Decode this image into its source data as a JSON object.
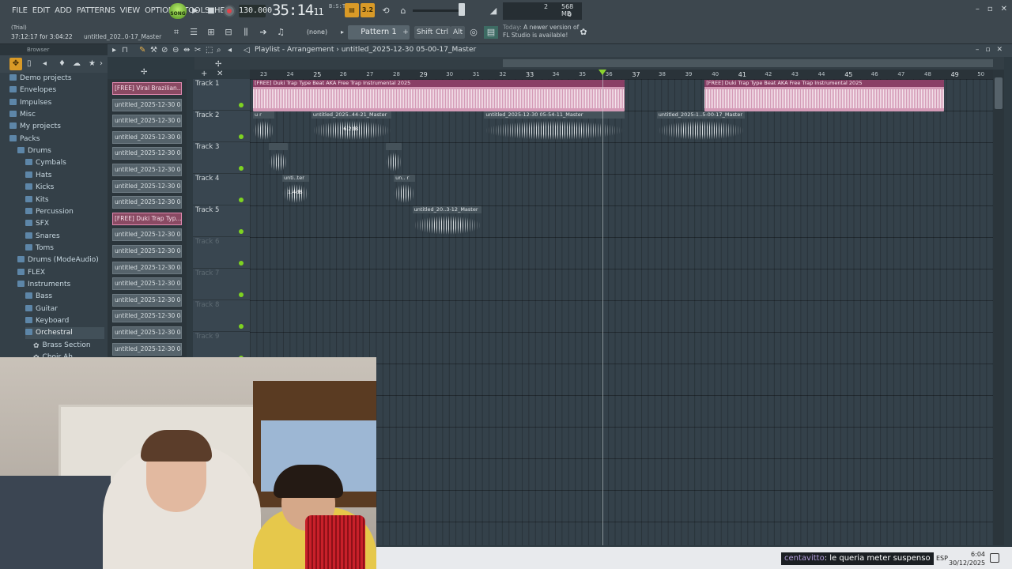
{
  "menu": [
    "FILE",
    "EDIT",
    "ADD",
    "PATTERNS",
    "VIEW",
    "OPTIONS",
    "TOOLS",
    "HELP"
  ],
  "transport": {
    "song_label": "SONG",
    "tempo": "130.000",
    "time": "35:14",
    "time_frac": "11",
    "time_unit": "B:S:T"
  },
  "toggles": {
    "metro": "3.2"
  },
  "cpu": {
    "voices": "2",
    "mem": "568 MB",
    "poly": "0"
  },
  "status": {
    "trial": "(Trial)",
    "hint_time": "37:12:17 for 3:04:22",
    "hint_file": "untitled_202..0-17_Master"
  },
  "pattern": {
    "none_label": "(none)",
    "name": "Pattern 1"
  },
  "modifiers": [
    "Shift",
    "Ctrl",
    "Alt"
  ],
  "news": {
    "line1_a": "Today:",
    "line1_b": "A newer version of",
    "line2": "FL Studio is available!"
  },
  "browser": {
    "title": "Browser",
    "items": [
      {
        "label": "Demo projects",
        "indent": 0
      },
      {
        "label": "Envelopes",
        "indent": 0
      },
      {
        "label": "Impulses",
        "indent": 0
      },
      {
        "label": "Misc",
        "indent": 0
      },
      {
        "label": "My projects",
        "indent": 0
      },
      {
        "label": "Packs",
        "indent": 0
      },
      {
        "label": "Drums",
        "indent": 1
      },
      {
        "label": "Cymbals",
        "indent": 2
      },
      {
        "label": "Hats",
        "indent": 2
      },
      {
        "label": "Kicks",
        "indent": 2
      },
      {
        "label": "Kits",
        "indent": 2
      },
      {
        "label": "Percussion",
        "indent": 2
      },
      {
        "label": "SFX",
        "indent": 2
      },
      {
        "label": "Snares",
        "indent": 2
      },
      {
        "label": "Toms",
        "indent": 2
      },
      {
        "label": "Drums (ModeAudio)",
        "indent": 1
      },
      {
        "label": "FLEX",
        "indent": 1
      },
      {
        "label": "Instruments",
        "indent": 1
      },
      {
        "label": "Bass",
        "indent": 2
      },
      {
        "label": "Guitar",
        "indent": 2
      },
      {
        "label": "Keyboard",
        "indent": 2
      },
      {
        "label": "Orchestral",
        "indent": 2
      },
      {
        "label": "Brass Section",
        "indent": 3
      },
      {
        "label": "Choir Ah",
        "indent": 3
      }
    ]
  },
  "clip_list": [
    {
      "label": "[FREE] Viral Brazilian...",
      "hl": true
    },
    {
      "label": "untitled_2025-12-30 04-",
      "hl": false
    },
    {
      "label": "untitled_2025-12-30 04-",
      "hl": false
    },
    {
      "label": "untitled_2025-12-30 04-",
      "hl": false
    },
    {
      "label": "untitled_2025-12-30 04-",
      "hl": false
    },
    {
      "label": "untitled_2025-12-30 04-",
      "hl": false
    },
    {
      "label": "untitled_2025-12-30 04-",
      "hl": false
    },
    {
      "label": "untitled_2025-12-30 04-",
      "hl": false
    },
    {
      "label": "[FREE] Duki Trap Typ...",
      "hl": true
    },
    {
      "label": "untitled_2025-12-30 04-",
      "hl": false
    },
    {
      "label": "untitled_2025-12-30 04-",
      "hl": false
    },
    {
      "label": "untitled_2025-12-30 04-",
      "hl": false
    },
    {
      "label": "untitled_2025-12-30 04-",
      "hl": false
    },
    {
      "label": "untitled_2025-12-30 04-",
      "hl": false
    },
    {
      "label": "untitled_2025-12-30 04-",
      "hl": false
    },
    {
      "label": "untitled_2025-12-30 04-",
      "hl": false
    },
    {
      "label": "untitled_2025-12-30 04-",
      "hl": false
    }
  ],
  "playlist": {
    "title": "Playlist - Arrangement",
    "separator": "›",
    "pattern": "untitled_2025-12-30 05-00-17_Master",
    "ruler": [
      "23",
      "24",
      "25",
      "26",
      "27",
      "28",
      "29",
      "30",
      "31",
      "32",
      "33",
      "34",
      "35",
      "36",
      "37",
      "38",
      "39",
      "40",
      "41",
      "42",
      "43",
      "44",
      "45",
      "46",
      "47",
      "48",
      "49",
      "50"
    ],
    "tracks": [
      "Track 1",
      "Track 2",
      "Track 3",
      "Track 4",
      "Track 5",
      "Track 6",
      "Track 7",
      "Track 8",
      "Track 9"
    ],
    "clips": [
      {
        "track": 0,
        "start": 23,
        "len": 14,
        "name": "[FREE] Duki Trap Type Beat AKA  Free Trap Instrumental 2025",
        "kind": "pink"
      },
      {
        "track": 0,
        "start": 40,
        "len": 9,
        "name": "[FREE] Duki Trap Type Beat AKA  Free Trap Instrumental 2025",
        "kind": "pink"
      },
      {
        "track": 1,
        "start": 23,
        "len": 0.8,
        "name": "u r",
        "kind": "grey"
      },
      {
        "track": 1,
        "start": 25.2,
        "len": 3,
        "name": "untitled_2025..44-21_Master",
        "kind": "grey",
        "db": "6.2dB"
      },
      {
        "track": 1,
        "start": 31.7,
        "len": 5.3,
        "name": "untitled_2025-12-30 05-54-11_Master",
        "kind": "grey"
      },
      {
        "track": 1,
        "start": 38.2,
        "len": 3.3,
        "name": "untitled_2025-1..5-00-17_Master",
        "kind": "grey"
      },
      {
        "track": 2,
        "start": 23.6,
        "len": 0.7,
        "name": "",
        "kind": "grey"
      },
      {
        "track": 2,
        "start": 28,
        "len": 0.6,
        "name": "",
        "kind": "grey"
      },
      {
        "track": 3,
        "start": 24.1,
        "len": 1,
        "name": "unti..ter",
        "kind": "grey",
        "db": "1.4dB"
      },
      {
        "track": 3,
        "start": 28.3,
        "len": 0.8,
        "name": "un.. r",
        "kind": "grey"
      },
      {
        "track": 4,
        "start": 29,
        "len": 2.6,
        "name": "untitled_20..3-12_Master",
        "kind": "grey"
      }
    ]
  },
  "chat": {
    "user": "centavitto",
    "message": ": le queria meter suspenso"
  },
  "tray": {
    "lang": "ESP",
    "time": "6:04",
    "date": "30/12/2025"
  }
}
